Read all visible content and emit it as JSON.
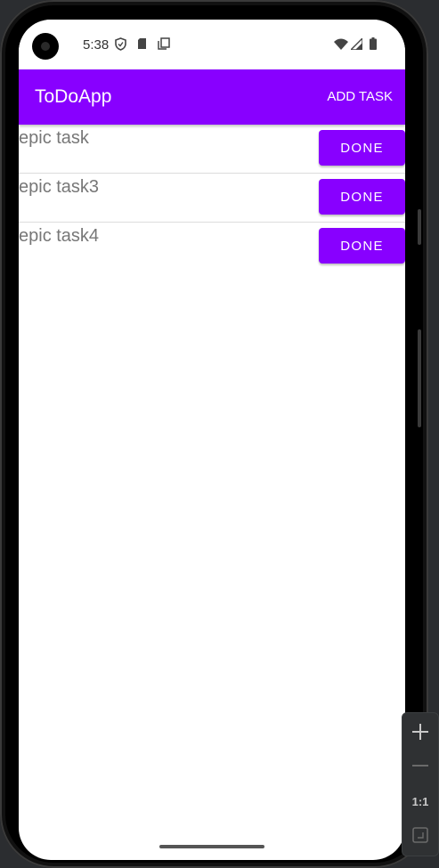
{
  "status_bar": {
    "time": "5:38",
    "icons": [
      "shield-icon",
      "sd-card-icon",
      "copy-icon",
      "wifi-icon",
      "signal-icon",
      "battery-icon"
    ]
  },
  "app_bar": {
    "title": "ToDoApp",
    "add_task_label": "ADD TASK",
    "color": "#8800ff"
  },
  "tasks": [
    {
      "text": "epic task",
      "button": "DONE"
    },
    {
      "text": "epic task3",
      "button": "DONE"
    },
    {
      "text": "epic task4",
      "button": "DONE"
    }
  ],
  "zoom_controls": {
    "one_to_one_label": "1:1",
    "icons": [
      "zoom-in-icon",
      "zoom-out-icon",
      "fit-screen-icon"
    ]
  }
}
